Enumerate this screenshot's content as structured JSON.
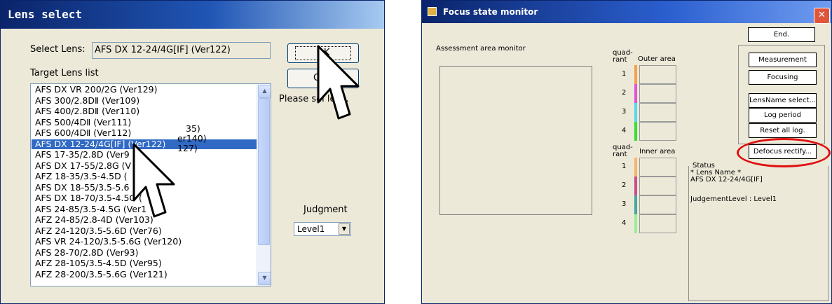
{
  "lens_select": {
    "title": "Lens select",
    "select_lens_label": "Select Lens:",
    "select_lens_value": "AFS DX 12-24/4G[IF] (Ver122)",
    "target_list_label": "Target Lens list",
    "items": [
      "AFS DX VR 200/2G (Ver129)",
      "AFS 300/2.8DⅡ (Ver109)",
      "AFS 400/2.8DⅡ (Ver110)",
      "AFS 500/4DⅡ (Ver111)",
      "AFS 600/4DⅡ (Ver112)",
      "AFS DX 12-24/4G[IF] (Ver122)",
      "AFS 17-35/2.8D (Ver9",
      "AFS DX 17-55/2.8G (V",
      "AFZ 18-35/3.5-4.5D (",
      "AFS DX 18-55/3.5-5.6",
      "AFS DX 18-70/3.5-4.5G (",
      "AFS 24-85/3.5-4.5G (Ver1",
      "AFZ 24-85/2.8-4D (Ver103)",
      "AFZ 24-120/3.5-5.6D (Ver76)",
      "AFS VR 24-120/3.5-5.6G (Ver120)",
      "AFS 28-70/2.8D (Ver93)",
      "AFZ 28-105/3.5-4.5D (Ver95)",
      "AFZ 28-200/3.5-5.6G (Ver121)"
    ],
    "item_fragments": [
      "35)",
      "er140)",
      "127)"
    ],
    "selected_index": 5,
    "ok_label": "OK",
    "cancel_label": "Ca",
    "hint": "Please sel  lens.",
    "judgment_label": "Judgment",
    "judgment_value": "Level1"
  },
  "focus_monitor": {
    "title": "Focus state monitor",
    "close_glyph": "✕",
    "end_label": "End.",
    "assessment_label": "Assessment area monitor",
    "quadrant_label_1": "quad-",
    "quadrant_label_2": "rant",
    "outer_label": "Outer area",
    "inner_label": "Inner area",
    "outer_rows": [
      "1",
      "2",
      "3",
      "4"
    ],
    "inner_rows": [
      "1",
      "2",
      "3",
      "4"
    ],
    "outer_colors": [
      "#f6a04d",
      "#e055d8",
      "#55d8f0",
      "#35e035"
    ],
    "inner_colors": [
      "#f6b56b",
      "#c8508a",
      "#45a8a0",
      "#98f098"
    ],
    "buttons": {
      "measurement": "Measurement",
      "focusing": "Focusing",
      "lensname": "LensName select...",
      "log_period": "Log period",
      "reset_log": "Reset all log.",
      "defocus": "Defocus rectify..."
    },
    "highlight_color": "#e01010",
    "status_label": "Status",
    "status_lines": [
      "* Lens Name *",
      "AFS DX 12-24/4G[IF]",
      "",
      "JudgementLevel : Level1"
    ]
  }
}
